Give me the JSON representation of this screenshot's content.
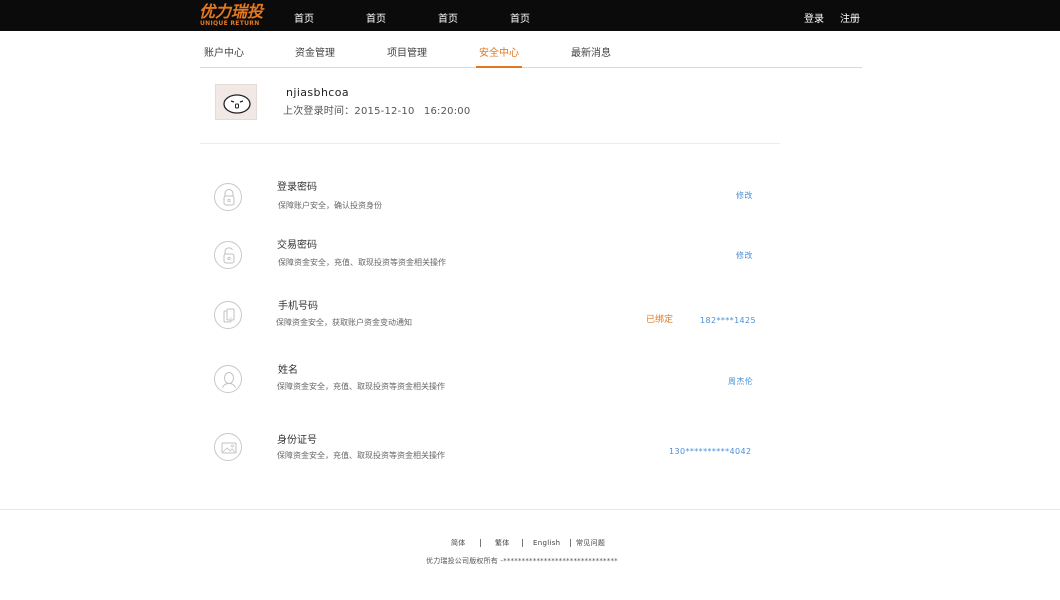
{
  "header": {
    "logo_cn": "优力瑞投",
    "logo_en": "UNIQUE RETURN",
    "nav": [
      "首页",
      "首页",
      "首页",
      "首页"
    ],
    "login": "登录",
    "register": "注册"
  },
  "subnav": {
    "items": [
      "账户中心",
      "资金管理",
      "项目管理",
      "安全中心",
      "最新消息"
    ],
    "active_index": 3
  },
  "profile": {
    "username": "njiasbhcoa",
    "last_login_label": "上次登录时间：2015-12-10",
    "last_login_time": "16:20:00"
  },
  "security": [
    {
      "icon": "lock-icon",
      "title": "登录密码",
      "desc": "保障账户安全，确认投资身份",
      "status": "",
      "action": "修改"
    },
    {
      "icon": "unlock-icon",
      "title": "交易密码",
      "desc": "保障资金安全，充值、取现投资等资金相关操作",
      "status": "",
      "action": "修改"
    },
    {
      "icon": "phone-icon",
      "title": "手机号码",
      "desc": "保障资金安全，获取账户资金变动通知",
      "status": "已绑定",
      "action": "182****1425"
    },
    {
      "icon": "person-icon",
      "title": "姓名",
      "desc": "保障资金安全，充值、取现投资等资金相关操作",
      "status": "",
      "action": "周杰伦"
    },
    {
      "icon": "id-card-icon",
      "title": "身份证号",
      "desc": "保障资金安全，充值、取现投资等资金相关操作",
      "status": "",
      "action": "130**********4042"
    }
  ],
  "footer": {
    "links": [
      "简体",
      "繁体",
      "English",
      "常见问题"
    ],
    "copyright": "优力瑞投公司版权所有 -*******************************"
  },
  "colors": {
    "accent": "#e3781f",
    "link": "#4a90d9",
    "topbar": "#0b0b0b"
  }
}
